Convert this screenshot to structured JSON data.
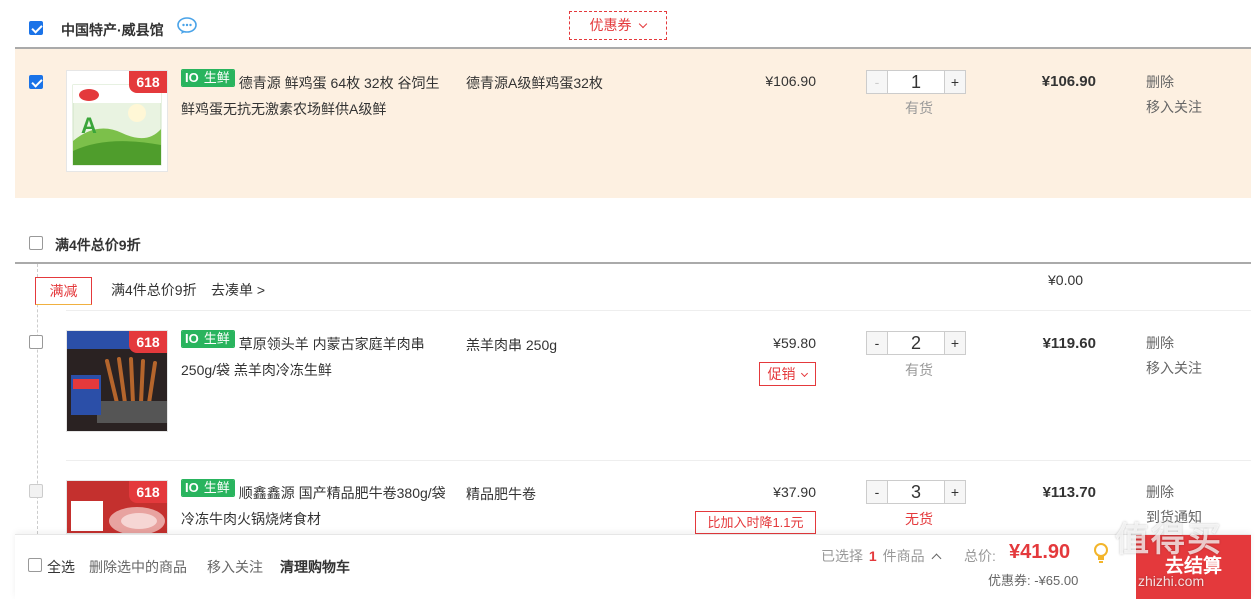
{
  "shop1": {
    "name": "中国特产·威县馆",
    "coupon_label": "优惠券",
    "items": [
      {
        "fresh_tag_1": "10",
        "fresh_tag_2": "生鲜",
        "title": "德青源 鲜鸡蛋 64枚 32枚 谷饲生鲜鸡蛋无抗无激素农场鲜供A级鲜",
        "spec": "德青源A级鲜鸡蛋32枚",
        "price": "¥106.90",
        "qty": "1",
        "stock": "有货",
        "subtotal": "¥106.90",
        "op1": "删除",
        "op2": "移入关注",
        "badge": "618"
      }
    ]
  },
  "promo_group": {
    "title": "满4件总价9折",
    "tag": "满减",
    "desc": "满4件总价9折",
    "link": "去凑单 >",
    "discount": "¥0.00",
    "items": [
      {
        "fresh_tag_1": "10",
        "fresh_tag_2": "生鲜",
        "title": "草原领头羊 内蒙古家庭羊肉串250g/袋 羔羊肉冷冻生鲜",
        "spec": "羔羊肉串 250g",
        "price": "¥59.80",
        "promo": "促销",
        "qty": "2",
        "stock": "有货",
        "subtotal": "¥119.60",
        "op1": "删除",
        "op2": "移入关注",
        "badge": "618"
      },
      {
        "fresh_tag_1": "10",
        "fresh_tag_2": "生鲜",
        "title": "顺鑫鑫源 国产精品肥牛卷380g/袋 冷冻牛肉火锅烧烤食材",
        "spec": "精品肥牛卷",
        "price": "¥37.90",
        "drop_note": "比加入时降1.1元",
        "qty": "3",
        "stock": "无货",
        "subtotal": "¥113.70",
        "op1": "删除",
        "op2": "到货通知",
        "badge": "618"
      }
    ]
  },
  "footer": {
    "select_all": "全选",
    "delete_selected": "删除选中的商品",
    "move_to_follow": "移入关注",
    "clear_cart": "清理购物车",
    "selected_prefix": "已选择",
    "selected_count": "1",
    "selected_suffix": "件商品",
    "total_label": "总价:",
    "total_value": "¥41.90",
    "coupon_label": "优惠券:",
    "coupon_value": "-¥65.00",
    "checkout_label": "去结算",
    "watermark": "值得买",
    "watermark_url": "zhizhi.com"
  },
  "colors": {
    "accent_red": "#e4393c",
    "check_blue": "#1a73e8",
    "fresh_green": "#29b45e",
    "selected_row_bg": "#fdf0e1"
  }
}
